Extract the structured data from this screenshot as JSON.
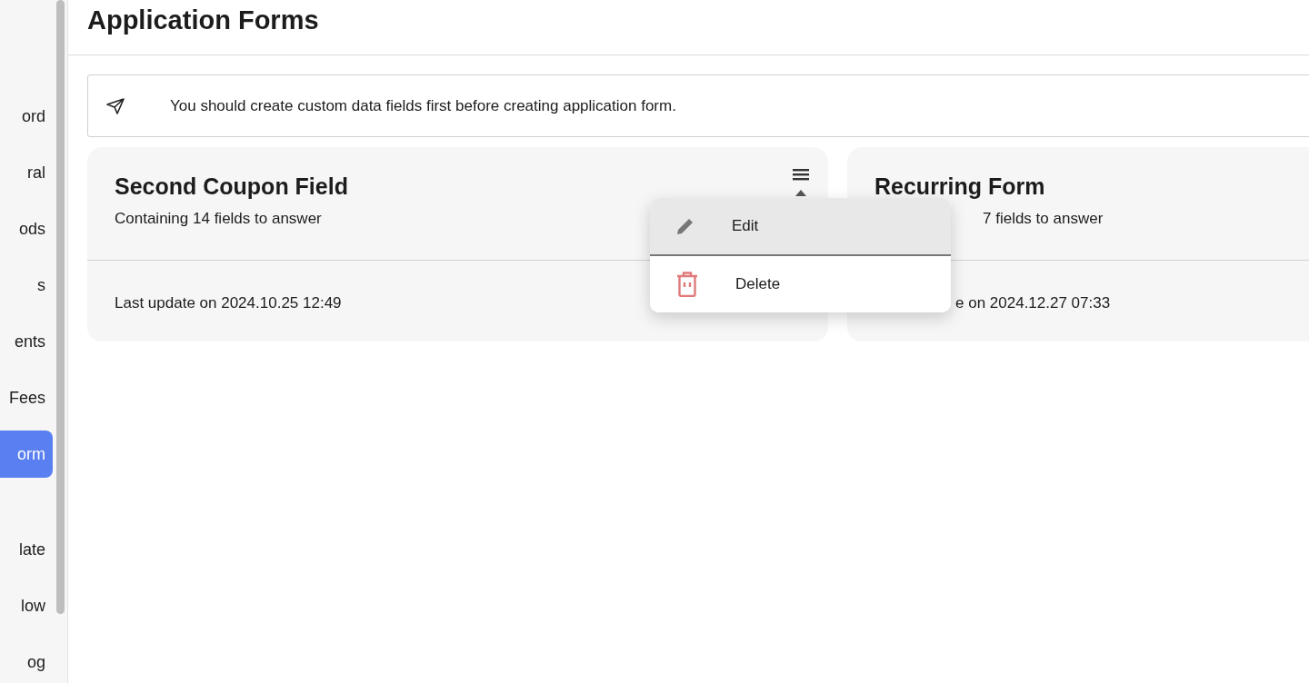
{
  "sidebar": {
    "items": [
      {
        "label": "ord",
        "selected": false
      },
      {
        "label": "ral",
        "selected": false
      },
      {
        "label": "ods",
        "selected": false
      },
      {
        "label": "s",
        "selected": false
      },
      {
        "label": "ents",
        "selected": false
      },
      {
        "label": "Fees",
        "selected": false
      },
      {
        "label": "orm",
        "selected": true
      },
      {
        "label": "late",
        "selected": false
      },
      {
        "label": "low",
        "selected": false
      },
      {
        "label": "og",
        "selected": false
      }
    ]
  },
  "page": {
    "title": "Application Forms"
  },
  "notice": {
    "text": "You should create custom data fields first before creating application form."
  },
  "cards": [
    {
      "title": "Second Coupon Field",
      "subtitle": "Containing 14 fields to answer",
      "updated": "Last update on 2024.10.25 12:49",
      "menu": {
        "items": [
          {
            "kind": "edit",
            "label": "Edit",
            "hovered": true
          },
          {
            "kind": "delete",
            "label": "Delete",
            "hovered": false
          }
        ]
      }
    },
    {
      "title": "Recurring Form",
      "subtitle": "7 fields to answer",
      "updated": "e on 2024.12.27 07:33",
      "partly_covered": true
    }
  ]
}
